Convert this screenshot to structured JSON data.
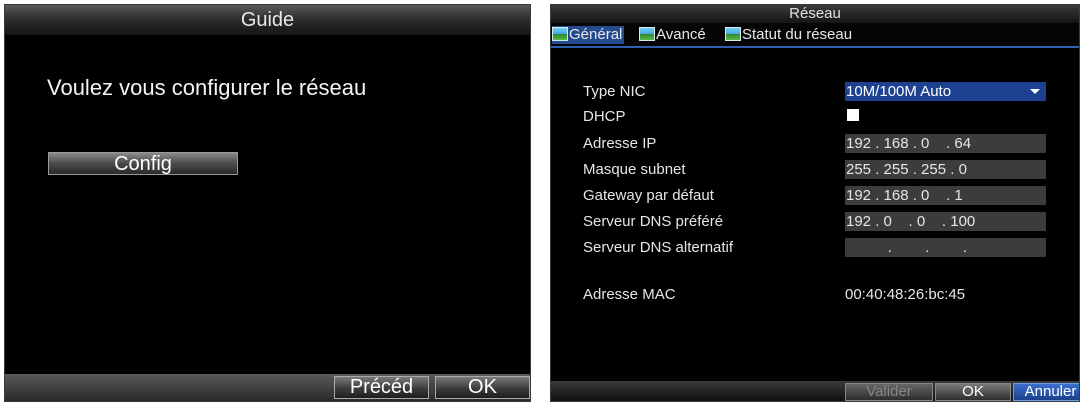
{
  "guide": {
    "title": "Guide",
    "question": "Voulez vous configurer le réseau",
    "config_button": "Config",
    "prev_button": "Précéd",
    "ok_button": "OK"
  },
  "network": {
    "title": "Réseau",
    "tabs": [
      {
        "label": "Général",
        "icon": "network-icon",
        "active": true
      },
      {
        "label": "Avancé",
        "icon": "network-icon",
        "active": false
      },
      {
        "label": "Statut du réseau",
        "icon": "network-icon",
        "active": false
      }
    ],
    "fields": {
      "nic_type": {
        "label": "Type NIC",
        "value": "10M/100M Auto"
      },
      "dhcp": {
        "label": "DHCP",
        "checked": false
      },
      "ip": {
        "label": "Adresse IP",
        "value": "192 . 168 . 0    . 64"
      },
      "subnet": {
        "label": "Masque subnet",
        "value": "255 . 255 . 255 . 0"
      },
      "gateway": {
        "label": "Gateway par défaut",
        "value": "192 . 168 . 0    . 1"
      },
      "dns_pref": {
        "label": "Serveur DNS préféré",
        "value": "192 . 0    . 0    . 100"
      },
      "dns_alt": {
        "label": "Serveur DNS alternatif",
        "value": "          .        .        ."
      },
      "mac": {
        "label": "Adresse MAC",
        "value": "00:40:48:26:bc:45"
      }
    },
    "buttons": {
      "apply": "Valider",
      "ok": "OK",
      "cancel": "Annuler"
    }
  },
  "colors": {
    "accent": "#234b8e",
    "background": "#000000",
    "field": "#3c3c3c"
  }
}
